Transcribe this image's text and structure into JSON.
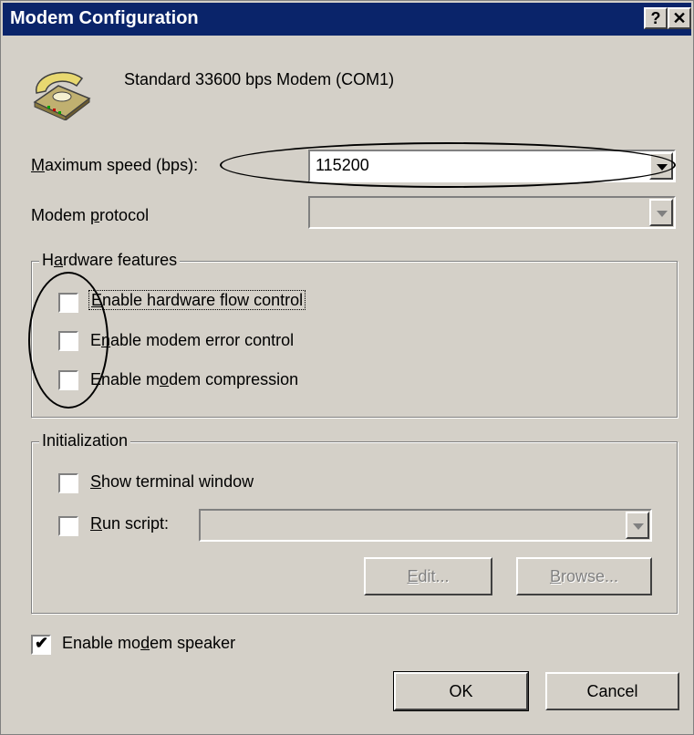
{
  "window": {
    "title": "Modem Configuration",
    "help_label": "?",
    "close_label": "✕"
  },
  "modem": {
    "name": "Standard 33600 bps Modem (COM1)",
    "icon": "telephone-icon"
  },
  "max_speed": {
    "label_u": "M",
    "label_rest": "aximum speed (bps):",
    "value": "115200"
  },
  "protocol": {
    "label_pre": "Modem ",
    "label_u": "p",
    "label_rest": "rotocol",
    "value": ""
  },
  "hardware": {
    "title_pre": "H",
    "title_u": "a",
    "title_rest": "rdware features",
    "flow": {
      "pre": "",
      "u": "E",
      "rest": "nable hardware flow control",
      "checked": false
    },
    "error": {
      "pre": "E",
      "u": "n",
      "rest": "able modem error control",
      "checked": false
    },
    "compression": {
      "pre": "Enable m",
      "u": "o",
      "rest": "dem compression",
      "checked": false
    }
  },
  "init": {
    "title": "Initialization",
    "terminal": {
      "u": "S",
      "rest": "how terminal window",
      "checked": false
    },
    "script": {
      "u": "R",
      "rest": "un script:",
      "checked": false,
      "value": ""
    },
    "edit": {
      "u": "E",
      "rest": "dit..."
    },
    "browse": {
      "u": "B",
      "rest": "rowse..."
    }
  },
  "speaker": {
    "pre": "Enable mo",
    "u": "d",
    "rest": "em speaker",
    "checked": true,
    "check_glyph": "✔"
  },
  "buttons": {
    "ok": "OK",
    "cancel": "Cancel"
  },
  "colors": {
    "titlebar": "#0a246a",
    "face": "#d4d0c8"
  }
}
